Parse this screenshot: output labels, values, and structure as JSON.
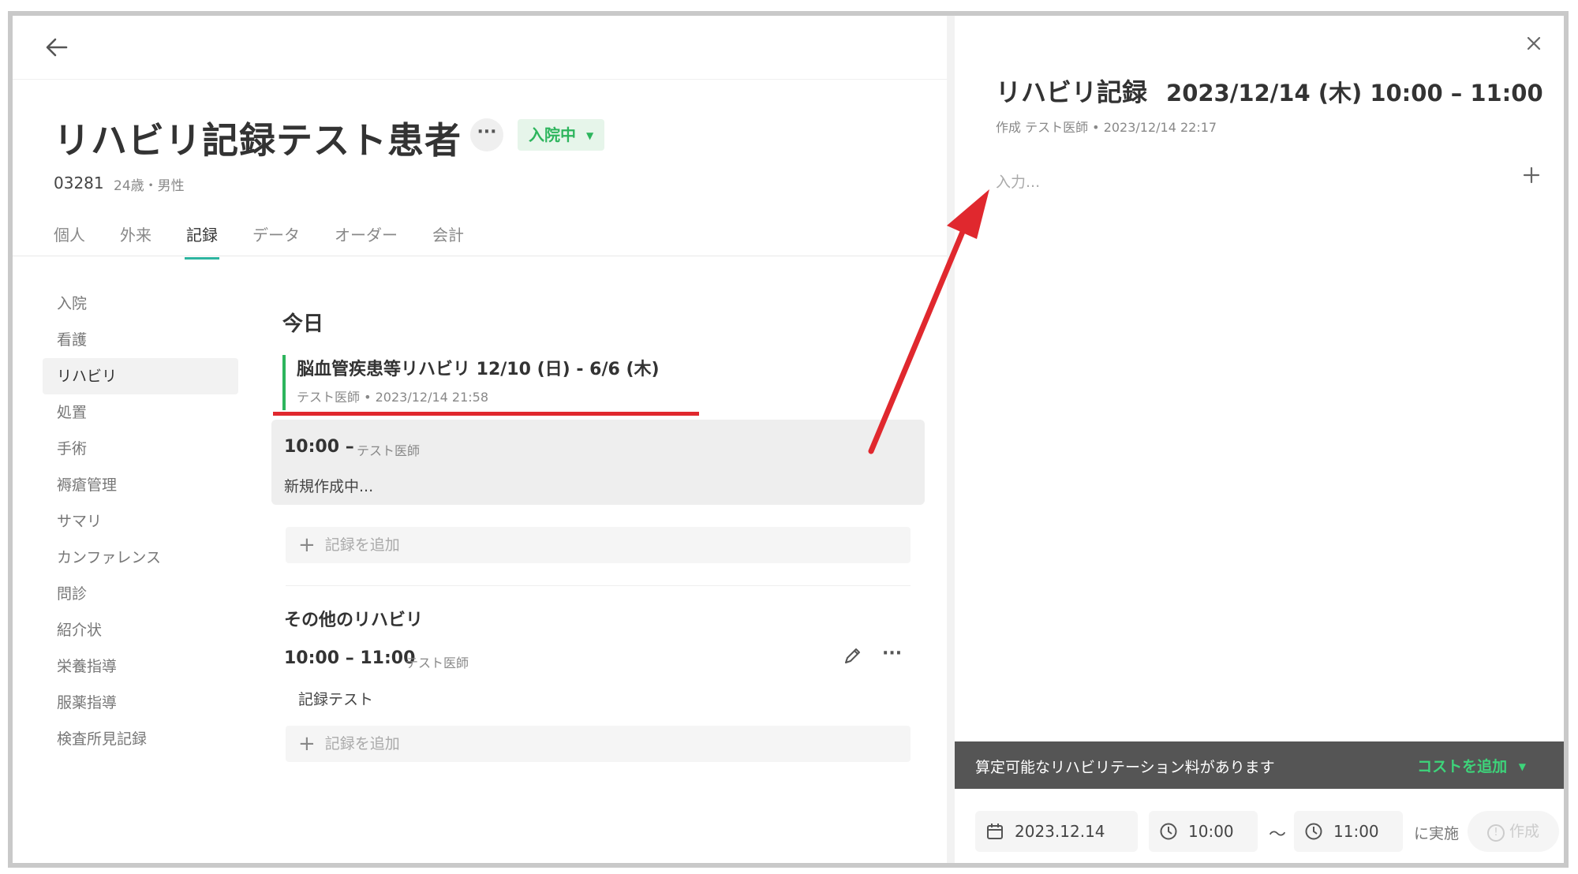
{
  "header": {
    "back_icon": "arrow-left-icon"
  },
  "patient": {
    "name": "リハビリ記録テスト患者",
    "more_label": "···",
    "status_label": "入院中",
    "id": "03281",
    "info": "24歳・男性"
  },
  "tabs": [
    {
      "label": "個人"
    },
    {
      "label": "外来"
    },
    {
      "label": "記録"
    },
    {
      "label": "データ"
    },
    {
      "label": "オーダー"
    },
    {
      "label": "会計"
    }
  ],
  "sidebar": {
    "items": [
      {
        "label": "入院"
      },
      {
        "label": "看護"
      },
      {
        "label": "リハビリ"
      },
      {
        "label": "処置"
      },
      {
        "label": "手術"
      },
      {
        "label": "褥瘡管理"
      },
      {
        "label": "サマリ"
      },
      {
        "label": "カンファレンス"
      },
      {
        "label": "問診"
      },
      {
        "label": "紹介状"
      },
      {
        "label": "栄養指導"
      },
      {
        "label": "服薬指導"
      },
      {
        "label": "検査所見記録"
      }
    ]
  },
  "main": {
    "today_heading": "今日",
    "course": {
      "title": "脳血管疾患等リハビリ 12/10 (日) - 6/6 (木)",
      "meta": "テスト医師 • 2023/12/14 21:58"
    },
    "current_record": {
      "time": "10:00 –",
      "author": "テスト医師",
      "text": "新規作成中..."
    },
    "add_record_label": "記録を追加",
    "other_heading": "その他のリハビリ",
    "other_record": {
      "time": "10:00 – 11:00",
      "author": "テスト医師",
      "text": "記録テスト"
    }
  },
  "panel": {
    "title_main": "リハビリ記録",
    "title_date": "2023/12/14 (木) 10:00 – 11:00",
    "meta": "作成 テスト医師 • 2023/12/14 22:17",
    "input_placeholder": "入力...",
    "notice": "算定可能なリハビリテーション料があります",
    "add_cost_label": "コストを追加",
    "date_value": "2023.12.14",
    "start_time": "10:00",
    "end_time": "11:00",
    "tilde": "〜",
    "performed_label": "に実施",
    "create_label": "作成"
  },
  "colors": {
    "accent_green": "#2db55d",
    "tab_underline": "#2db5a0",
    "annotation_red": "#e0282e",
    "notice_bar": "#555555"
  }
}
